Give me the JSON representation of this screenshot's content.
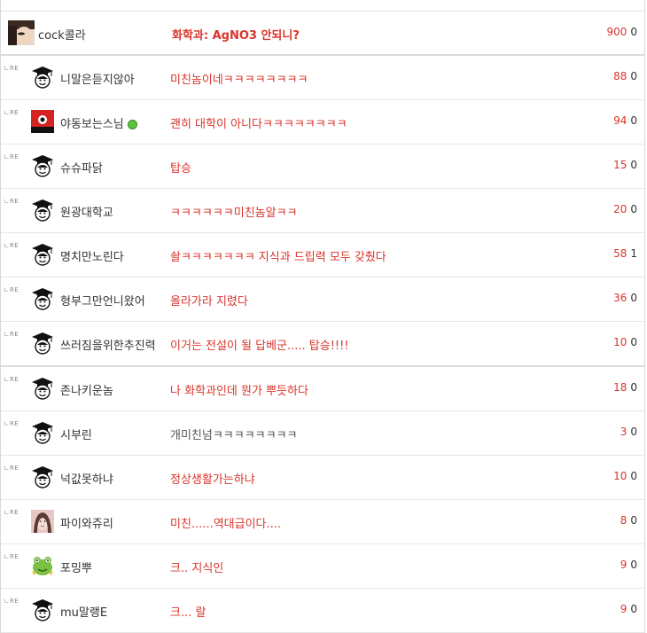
{
  "header": {
    "nickname": "cock콜라",
    "comment": "화학과: AgNO3 안되니?",
    "up": "900",
    "down": "0"
  },
  "reply_mark": "ㄴRE",
  "replies": [
    {
      "nickname": "니말은듣지않아",
      "comment": "미친놈이네ㅋㅋㅋㅋㅋㅋㅋㅋ",
      "up": "88",
      "down": "0",
      "avatar": "graduate-cap-icon"
    },
    {
      "nickname": "야동보는스님",
      "comment": "괜히 대학이 아니다ㅋㅋㅋㅋㅋㅋㅋㅋ",
      "up": "94",
      "down": "0",
      "avatar": "red-flag-icon"
    },
    {
      "nickname": "슈슈파닭",
      "comment": "탑승",
      "up": "15",
      "down": "0",
      "avatar": "graduate-cap-icon"
    },
    {
      "nickname": "원광대학교",
      "comment": "ㅋㅋㅋㅋㅋㅋ미친놈알ㅋㅋ",
      "up": "20",
      "down": "0",
      "avatar": "graduate-cap-icon"
    },
    {
      "nickname": "명치만노린다",
      "comment": "솰ㅋㅋㅋㅋㅋㅋㅋ 지식과 드립력 모두 갖췄다",
      "up": "58",
      "down": "1",
      "avatar": "graduate-cap-icon"
    },
    {
      "nickname": "형부그만언니왔어",
      "comment": "올라가라 지렸다",
      "up": "36",
      "down": "0",
      "avatar": "graduate-cap-icon"
    },
    {
      "nickname": "쓰러짐을위한추진력",
      "comment": "이거는 전설이 될 답베군..... 탑승!!!!",
      "up": "10",
      "down": "0",
      "avatar": "graduate-cap-icon"
    },
    {
      "nickname": "존나키운놈",
      "comment": "나 화학과인데 뭔가 뿌듯하다",
      "up": "18",
      "down": "0",
      "avatar": "graduate-cap-icon"
    },
    {
      "nickname": "시부린",
      "comment": "개미친넘ㅋㅋㅋㅋㅋㅋㅋㅋ",
      "up": "3",
      "down": "0",
      "avatar": "graduate-cap-icon"
    },
    {
      "nickname": "넉값못하냐",
      "comment": "정상생활가는하냐",
      "up": "10",
      "down": "0",
      "avatar": "graduate-cap-icon"
    },
    {
      "nickname": "파이와쥬리",
      "comment": "미친......역대급이다....",
      "up": "8",
      "down": "0",
      "avatar": "girl-photo-icon"
    },
    {
      "nickname": "포밍뿌",
      "comment": "크.. 지식인",
      "up": "9",
      "down": "0",
      "avatar": "frog-icon"
    },
    {
      "nickname": "mu말랭E",
      "comment": "크... 랄",
      "up": "9",
      "down": "0",
      "avatar": "graduate-cap-icon"
    }
  ]
}
